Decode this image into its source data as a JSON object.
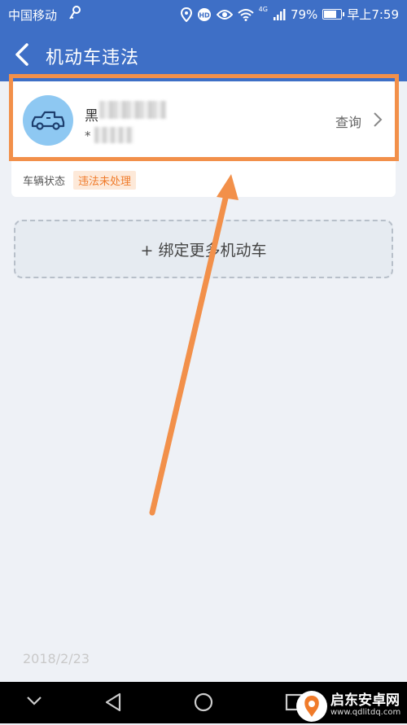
{
  "statusbar": {
    "carrier": "中国移动",
    "network": "4G",
    "battery": "79%",
    "battery_level": 0.79,
    "time": "早上7:59"
  },
  "appbar": {
    "title": "机动车违法"
  },
  "vehicle": {
    "plate_prefix": "黑",
    "sub_prefix": "*",
    "query_label": "查询",
    "status_label": "车辆状态",
    "status_value": "违法未处理"
  },
  "add_vehicle_label": "+ 绑定更多机动车",
  "date": "2018/2/23",
  "watermark": {
    "title": "启东安卓网",
    "url": "www.qdlitdq.com"
  },
  "colors": {
    "primary": "#3e6fc6",
    "annotation": "#f2904a",
    "status_text": "#f07b2a",
    "avatar_bg": "#8ec8f2"
  }
}
